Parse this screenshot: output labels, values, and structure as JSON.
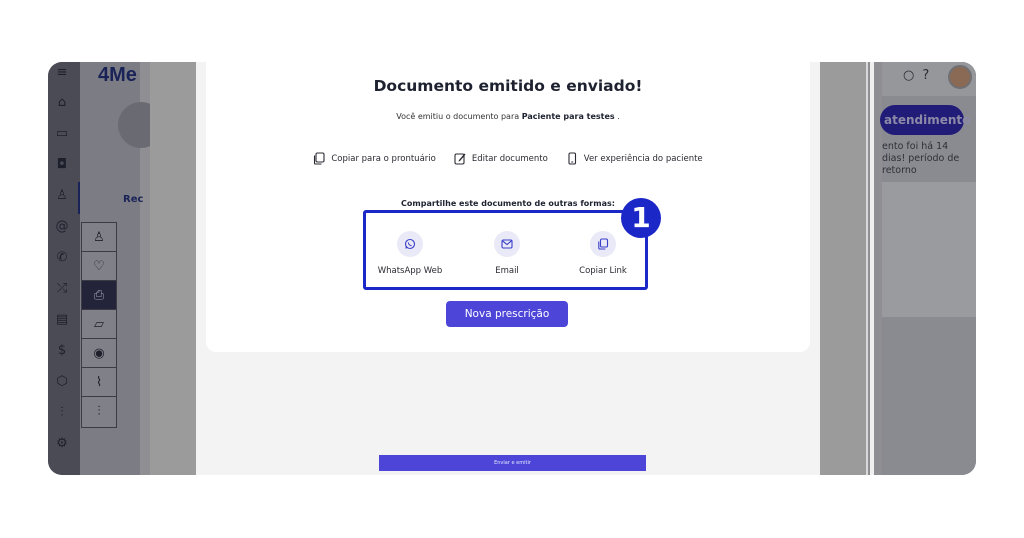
{
  "background_app": {
    "logo": "4Me",
    "tab_label": "Rec",
    "attend_button": "atendimento",
    "note": "ento foi há 14 dias! período de retorno"
  },
  "dialog": {
    "title": "Documento emitido e enviado!",
    "subtitle_prefix": "Você emitiu o documento para ",
    "patient_name": "Paciente para testes",
    "subtitle_suffix": " .",
    "actions": {
      "copy_record": "Copiar para o prontuário",
      "edit_document": "Editar documento",
      "patient_experience": "Ver experiência do paciente"
    },
    "share_title": "Compartilhe este documento de outras formas:",
    "share_options": {
      "whatsapp": "WhatsApp Web",
      "email": "Email",
      "copy_link": "Copiar Link"
    },
    "new_prescription": "Nova prescrição",
    "send_emit": "Enviar e emitir"
  },
  "annotation": {
    "step_number": "1",
    "color": "#1c27c8"
  },
  "colors": {
    "primary_button": "#4c45d8",
    "overlay_gray": "#9b9b9b"
  }
}
